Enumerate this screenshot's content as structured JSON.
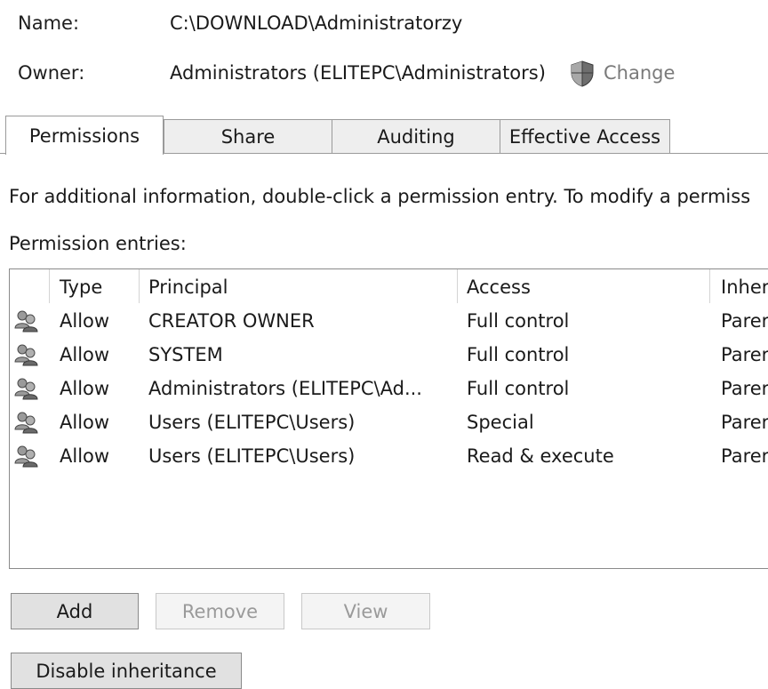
{
  "header": {
    "name_label": "Name:",
    "name_value": "C:\\DOWNLOAD\\Administratorzy",
    "owner_label": "Owner:",
    "owner_value": "Administrators (ELITEPC\\Administrators)",
    "change_label": "Change",
    "change_icon": "shield-icon"
  },
  "tabs": [
    {
      "label": "Permissions",
      "active": true
    },
    {
      "label": "Share",
      "active": false
    },
    {
      "label": "Auditing",
      "active": false
    },
    {
      "label": "Effective Access",
      "active": false
    }
  ],
  "info_text": "For additional information, double-click a permission entry. To modify a permiss",
  "entries_label": "Permission entries:",
  "table": {
    "columns": [
      "Type",
      "Principal",
      "Access",
      "Inher"
    ],
    "rows": [
      {
        "icon": "users-icon",
        "type": "Allow",
        "principal": "CREATOR OWNER",
        "access": "Full control",
        "inherited": "Parer"
      },
      {
        "icon": "users-icon",
        "type": "Allow",
        "principal": "SYSTEM",
        "access": "Full control",
        "inherited": "Parer"
      },
      {
        "icon": "users-icon",
        "type": "Allow",
        "principal": "Administrators (ELITEPC\\Ad...",
        "access": "Full control",
        "inherited": "Parer"
      },
      {
        "icon": "users-icon",
        "type": "Allow",
        "principal": "Users (ELITEPC\\Users)",
        "access": "Special",
        "inherited": "Parer"
      },
      {
        "icon": "users-icon",
        "type": "Allow",
        "principal": "Users (ELITEPC\\Users)",
        "access": "Read & execute",
        "inherited": "Parer"
      }
    ]
  },
  "buttons": {
    "add": "Add",
    "remove": "Remove",
    "view": "View",
    "disable_inheritance": "Disable inheritance"
  },
  "colors": {
    "tab_inactive": "#eeeeee",
    "button_face": "#e1e1e1",
    "disabled_text": "#9a9a9a"
  }
}
